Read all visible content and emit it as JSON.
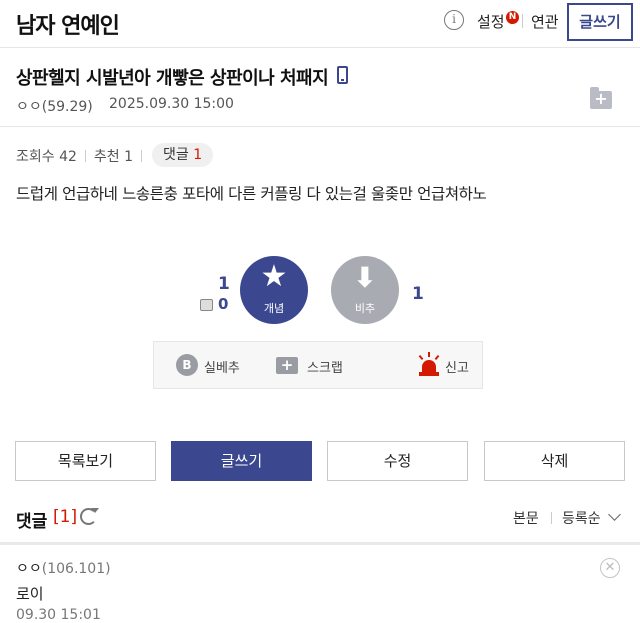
{
  "header": {
    "gallery_title": "남자 연예인",
    "info_glyph": "i",
    "settings_label": "설정",
    "new_badge": "N",
    "related_label": "연관",
    "write_label": "글쓰기"
  },
  "post": {
    "title": "상판헬지 시발년아 개빻은 상판이나 처패지",
    "author": "ㅇㅇ(59.29)",
    "date": "2025.09.30 15:00",
    "views_label": "조회수 42",
    "recommend_label": "추천 1",
    "comments_label": "댓글",
    "comments_count": "1",
    "body": "드럽게 언급하네 느송른충 포타에 다른 커플링 다 있는걸 울좆만 언급쳐하노"
  },
  "votes": {
    "up_count": "1",
    "fix_count": "0",
    "up_label": "개념",
    "up_glyph": "★",
    "down_label": "비추",
    "down_glyph": "⬇",
    "down_count": "1"
  },
  "actions": {
    "best_glyph": "B",
    "best_label": "실베추",
    "scrap_glyph": "+",
    "scrap_label": "스크랩",
    "report_label": "신고"
  },
  "buttons": {
    "list": "목록보기",
    "write": "글쓰기",
    "edit": "수정",
    "delete": "삭제"
  },
  "comments": {
    "title": "댓글",
    "count": "[1]",
    "sort_body": "본문",
    "sort_order": "등록순",
    "items": [
      {
        "author": "ㅇㅇ",
        "ip": "(106.101)",
        "text": "로이",
        "date": "09.30 15:01",
        "delete_glyph": "✕"
      }
    ]
  },
  "colors": {
    "brand": "#3b4890",
    "accent_red": "#d31900",
    "muted_button": "#a9abb2"
  }
}
